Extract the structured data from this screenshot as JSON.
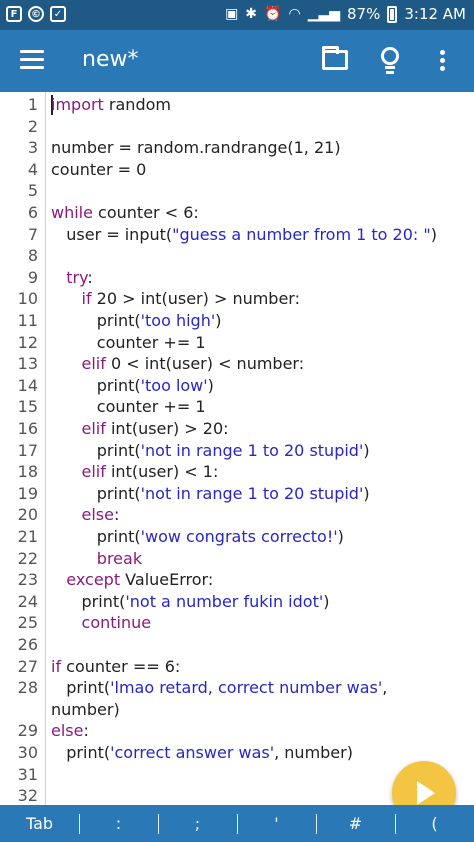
{
  "status_bar": {
    "battery_text": "87%",
    "time": "3:12 AM"
  },
  "app_bar": {
    "title": "new*",
    "icons": [
      "menu-icon",
      "folder-icon",
      "lightbulb-icon",
      "more-vert-icon"
    ]
  },
  "editor": {
    "lines": [
      {
        "n": "1",
        "tokens": [
          [
            "k",
            "import"
          ],
          [
            "t",
            " random"
          ]
        ]
      },
      {
        "n": "2",
        "tokens": []
      },
      {
        "n": "3",
        "tokens": [
          [
            "t",
            "number = random.randrange(1, 21)"
          ]
        ]
      },
      {
        "n": "4",
        "tokens": [
          [
            "t",
            "counter = 0"
          ]
        ]
      },
      {
        "n": "5",
        "tokens": []
      },
      {
        "n": "6",
        "tokens": [
          [
            "k",
            "while"
          ],
          [
            "t",
            " counter < 6:"
          ]
        ]
      },
      {
        "n": "7",
        "tokens": [
          [
            "t",
            "   user = input("
          ],
          [
            "s",
            "\"guess a number from 1 to 20: \""
          ],
          [
            "t",
            ")"
          ]
        ]
      },
      {
        "n": "8",
        "tokens": []
      },
      {
        "n": "9",
        "tokens": [
          [
            "t",
            "   "
          ],
          [
            "k",
            "try"
          ],
          [
            "t",
            ":"
          ]
        ]
      },
      {
        "n": "10",
        "tokens": [
          [
            "t",
            "      "
          ],
          [
            "k",
            "if"
          ],
          [
            "t",
            " 20 > int(user) > number:"
          ]
        ]
      },
      {
        "n": "11",
        "tokens": [
          [
            "t",
            "         print("
          ],
          [
            "s",
            "'too high'"
          ],
          [
            "t",
            ")"
          ]
        ]
      },
      {
        "n": "12",
        "tokens": [
          [
            "t",
            "         counter += 1"
          ]
        ]
      },
      {
        "n": "13",
        "tokens": [
          [
            "t",
            "      "
          ],
          [
            "k",
            "elif"
          ],
          [
            "t",
            " 0 < int(user) < number:"
          ]
        ]
      },
      {
        "n": "14",
        "tokens": [
          [
            "t",
            "         print("
          ],
          [
            "s",
            "'too low'"
          ],
          [
            "t",
            ")"
          ]
        ]
      },
      {
        "n": "15",
        "tokens": [
          [
            "t",
            "         counter += 1"
          ]
        ]
      },
      {
        "n": "16",
        "tokens": [
          [
            "t",
            "      "
          ],
          [
            "k",
            "elif"
          ],
          [
            "t",
            " int(user) > 20:"
          ]
        ]
      },
      {
        "n": "17",
        "tokens": [
          [
            "t",
            "         print("
          ],
          [
            "s",
            "'not in range 1 to 20 stupid'"
          ],
          [
            "t",
            ")"
          ]
        ]
      },
      {
        "n": "18",
        "tokens": [
          [
            "t",
            "      "
          ],
          [
            "k",
            "elif"
          ],
          [
            "t",
            " int(user) < 1:"
          ]
        ]
      },
      {
        "n": "19",
        "tokens": [
          [
            "t",
            "         print("
          ],
          [
            "s",
            "'not in range 1 to 20 stupid'"
          ],
          [
            "t",
            ")"
          ]
        ]
      },
      {
        "n": "20",
        "tokens": [
          [
            "t",
            "      "
          ],
          [
            "k",
            "else"
          ],
          [
            "t",
            ":"
          ]
        ]
      },
      {
        "n": "21",
        "tokens": [
          [
            "t",
            "         print("
          ],
          [
            "s",
            "'wow congrats correcto!'"
          ],
          [
            "t",
            ")"
          ]
        ]
      },
      {
        "n": "22",
        "tokens": [
          [
            "t",
            "         "
          ],
          [
            "k",
            "break"
          ]
        ]
      },
      {
        "n": "23",
        "tokens": [
          [
            "t",
            "   "
          ],
          [
            "k",
            "except"
          ],
          [
            "t",
            " ValueError:"
          ]
        ]
      },
      {
        "n": "24",
        "tokens": [
          [
            "t",
            "      print("
          ],
          [
            "s",
            "'not a number fukin idot'"
          ],
          [
            "t",
            ")"
          ]
        ]
      },
      {
        "n": "25",
        "tokens": [
          [
            "t",
            "      "
          ],
          [
            "k",
            "continue"
          ]
        ]
      },
      {
        "n": "26",
        "tokens": []
      },
      {
        "n": "27",
        "tokens": [
          [
            "k",
            "if"
          ],
          [
            "t",
            " counter == 6:"
          ]
        ]
      },
      {
        "n": "28",
        "tokens": [
          [
            "t",
            "   print("
          ],
          [
            "s",
            "'lmao retard, correct number was'"
          ],
          [
            "t",
            ","
          ]
        ]
      },
      {
        "n": "",
        "tokens": [
          [
            "t",
            "number)"
          ]
        ]
      },
      {
        "n": "29",
        "tokens": [
          [
            "k",
            "else"
          ],
          [
            "t",
            ":"
          ]
        ]
      },
      {
        "n": "30",
        "tokens": [
          [
            "t",
            "   print("
          ],
          [
            "s",
            "'correct answer was'"
          ],
          [
            "t",
            ", number)"
          ]
        ]
      },
      {
        "n": "31",
        "tokens": []
      },
      {
        "n": "32",
        "tokens": []
      }
    ]
  },
  "keybar": {
    "keys": [
      "Tab",
      ":",
      ";",
      "'",
      "#",
      "("
    ]
  },
  "fab": {
    "icon": "play-icon"
  },
  "colors": {
    "status_bar": "#1f5a86",
    "app_bar": "#2a78b5",
    "keyword": "#8a1b7d",
    "string": "#2626c9",
    "fab": "#f4c542"
  }
}
